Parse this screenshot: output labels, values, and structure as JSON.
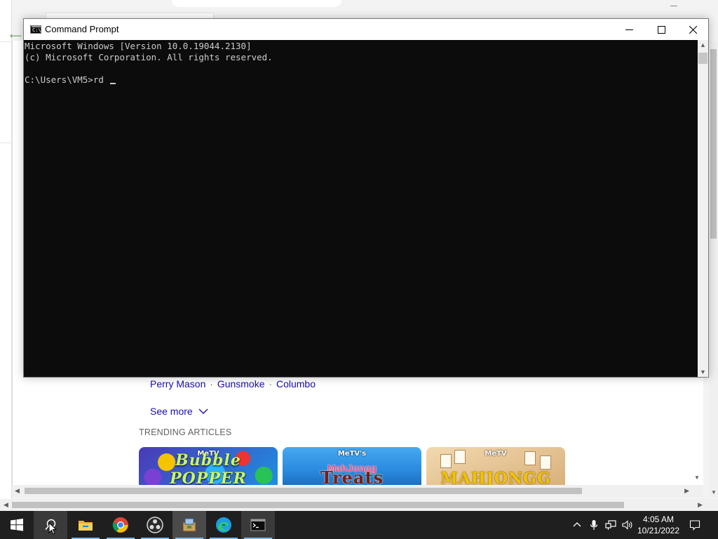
{
  "browser": {
    "show_links": [
      "Perry Mason",
      "Gunsmoke",
      "Columbo"
    ],
    "link_separator": "·",
    "see_more": "See more",
    "trending_heading": "TRENDING ARTICLES",
    "cards": [
      {
        "brand": "MeTV",
        "title": "Bubble POPPER"
      },
      {
        "brand": "MeTV's",
        "subtitle": "MahJongg",
        "title": "Treats"
      },
      {
        "brand": "MeTV",
        "title": "MAHJONGG"
      }
    ]
  },
  "cmd": {
    "title": "Command Prompt",
    "icon_text": "C:\\",
    "lines": [
      "Microsoft Windows [Version 10.0.19044.2130]",
      "(c) Microsoft Corporation. All rights reserved.",
      "",
      "C:\\Users\\VM5>rd "
    ],
    "colors": {
      "console_bg": "#0c0c0c",
      "console_fg": "#cccccc"
    }
  },
  "taskbar": {
    "apps": [
      {
        "name": "start",
        "icon": "windows-logo-icon"
      },
      {
        "name": "search",
        "icon": "search-icon"
      },
      {
        "name": "file-explorer",
        "icon": "folder-icon"
      },
      {
        "name": "chrome",
        "icon": "chrome-icon"
      },
      {
        "name": "obs",
        "icon": "obs-icon"
      },
      {
        "name": "installer",
        "icon": "installer-icon"
      },
      {
        "name": "edge",
        "icon": "edge-icon"
      },
      {
        "name": "command-prompt",
        "icon": "terminal-icon"
      }
    ],
    "tray_icons": [
      "chevron-up-icon",
      "microphone-icon",
      "network-icon",
      "speaker-icon",
      "notification-icon"
    ],
    "time": "4:05 AM",
    "date": "10/21/2022",
    "colors": {
      "bg": "#1f1f1f",
      "accent": "#76b9ed"
    }
  }
}
